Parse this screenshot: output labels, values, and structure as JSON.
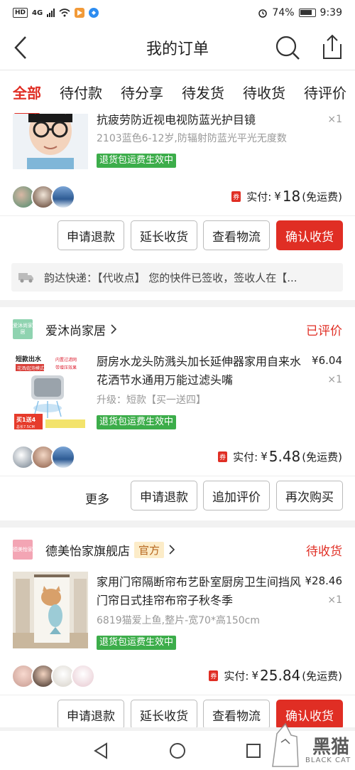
{
  "status_bar": {
    "network": "HD",
    "signal": "4G",
    "battery": "74%",
    "time": "9:39"
  },
  "header": {
    "title": "我的订单"
  },
  "tabs": [
    {
      "label": "全部",
      "active": true
    },
    {
      "label": "待付款",
      "active": false
    },
    {
      "label": "待分享",
      "active": false
    },
    {
      "label": "待发货",
      "active": false
    },
    {
      "label": "待收货",
      "active": false
    },
    {
      "label": "待评价",
      "active": false
    }
  ],
  "orders": [
    {
      "product": {
        "title": "抗疲劳防近视电视防蓝光护目镜",
        "spec": "2103蓝色6-12岁,防辐射防蓝光平光无度数",
        "qty": "×1",
        "return_badge": "退货包运费生效中"
      },
      "payment": {
        "coupon": "券",
        "label": "实付:",
        "currency": "¥",
        "amount": "18",
        "shipping": "(免运费)"
      },
      "buttons": [
        "申请退款",
        "延长收货",
        "查看物流",
        "确认收货"
      ],
      "logistics": "韵达快递：【代收点】 您的快件已签收，签收人在【..."
    },
    {
      "shop": {
        "logo_text": "爱沐尚家居",
        "name": "爱沐尚家居",
        "status": "已评价"
      },
      "product": {
        "title": "厨房水龙头防溅头加长延伸器家用自来水花洒节水通用万能过滤头嘴",
        "spec": "升级：短款【买一送四】",
        "price": "¥6.04",
        "qty": "×1",
        "return_badge": "退货包运费生效中",
        "thumb_texts": [
          "短款出水",
          "花洒/起泡模式",
          "内置过滤网",
          "带增压效果",
          "买1送4",
          "总长7.5CM"
        ]
      },
      "payment": {
        "coupon": "券",
        "label": "实付:",
        "currency": "¥",
        "amount": "5.48",
        "shipping": "(免运费)"
      },
      "more_label": "更多",
      "buttons": [
        "申请退款",
        "追加评价",
        "再次购买"
      ]
    },
    {
      "shop": {
        "logo_text": "德美怡家",
        "name": "德美怡家旗舰店",
        "official": "官方",
        "status": "待收货"
      },
      "product": {
        "title": "家用门帘隔断帘布艺卧室厨房卫生间挡风门帘日式挂帘布帘子秋冬季",
        "spec": "6819猫爱上鱼,整片-宽70*高150cm",
        "price": "¥28.46",
        "qty": "×1",
        "return_badge": "退货包运费生效中"
      },
      "payment": {
        "coupon": "券",
        "label": "实付:",
        "currency": "¥",
        "amount": "25.84",
        "shipping": "(免运费)"
      },
      "buttons": [
        "申请退款",
        "延长收货",
        "查看物流",
        "确认收货"
      ]
    }
  ],
  "watermark": {
    "text": "黑猫",
    "sub": "BLACK CAT"
  },
  "colors": {
    "accent": "#e02e24",
    "badge_green": "#3cad4a",
    "official_bg": "#fcecc8"
  }
}
